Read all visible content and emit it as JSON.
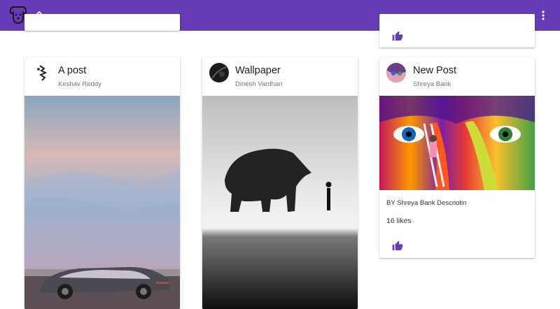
{
  "app": {
    "logo_icon": "dog-face-icon",
    "sort_icon": "unfold-icon",
    "menu_icon": "more-vert-icon",
    "accent_color": "#673ab7"
  },
  "posts": [
    {
      "title": "A post",
      "author": "Keshav Reddy",
      "image": "futuristic-car-at-sunset"
    },
    {
      "title": "Wallpaper",
      "author": "Dinesh Vardhan",
      "image": "bear-and-child-grayscale"
    },
    {
      "title": "New Post",
      "author": "Shreya Bank",
      "image": "colorful-painted-face",
      "caption": "BY Shreya Bank Descriotin",
      "likes": "16 likes",
      "like_icon": "thumb-up-icon"
    }
  ]
}
